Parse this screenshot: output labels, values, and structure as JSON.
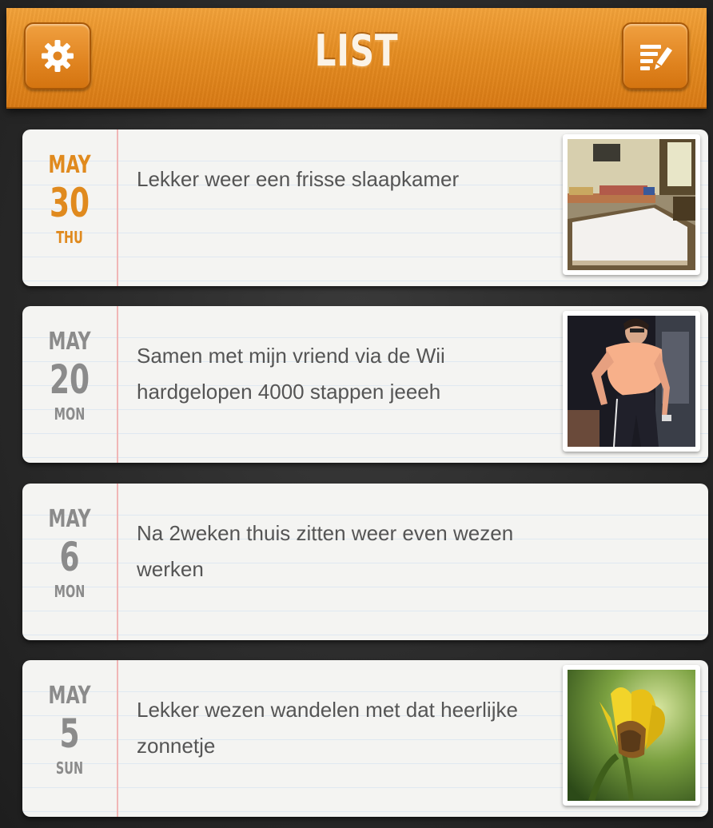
{
  "header": {
    "title": "LIST",
    "settings_icon": "gear-icon",
    "compose_icon": "compose-list-icon",
    "accent": "#e58d22"
  },
  "entries": [
    {
      "month": "MAY",
      "day": "30",
      "weekday": "THU",
      "text": "Lekker weer een frisse slaapkamer",
      "highlighted": true,
      "has_photo": true
    },
    {
      "month": "MAY",
      "day": "20",
      "weekday": "MON",
      "text": "Samen met mijn vriend via de Wii hardgelopen 4000 stappen jeeeh",
      "highlighted": false,
      "has_photo": true
    },
    {
      "month": "MAY",
      "day": "6",
      "weekday": "MON",
      "text": "Na 2weken thuis zitten weer even wezen werken",
      "highlighted": false,
      "has_photo": false
    },
    {
      "month": "MAY",
      "day": "5",
      "weekday": "SUN",
      "text": "Lekker wezen wandelen met dat heerlijke zonnetje",
      "highlighted": false,
      "has_photo": true
    }
  ],
  "colors": {
    "date_highlight": "#e08a1e",
    "date_default": "#8b8b8b",
    "margin_line": "#f0b6b6",
    "ruled_line": "#dfe8f1"
  }
}
